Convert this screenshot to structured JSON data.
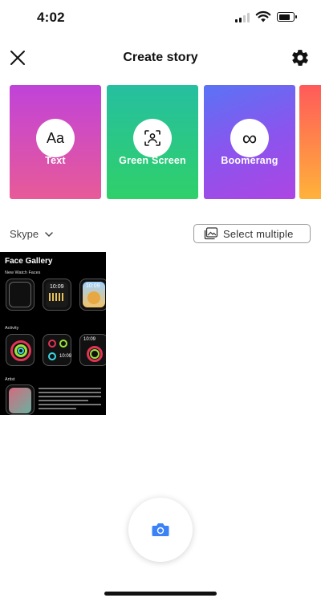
{
  "status_bar": {
    "time": "4:02"
  },
  "header": {
    "title": "Create story"
  },
  "cards": [
    {
      "label": "Text",
      "icon": "text-aa-icon",
      "icon_text": "Aa",
      "colors": [
        "#c043d9",
        "#e85a98"
      ]
    },
    {
      "label": "Green Screen",
      "icon": "green-screen-icon",
      "colors": [
        "#27c09a",
        "#2fd06a"
      ]
    },
    {
      "label": "Boomerang",
      "icon": "infinity-icon",
      "icon_text": "∞",
      "colors": [
        "#5b6cf2",
        "#a54ae6"
      ]
    },
    {
      "label": "",
      "icon": "",
      "colors": [
        "#ff5a5a",
        "#ffb23a"
      ]
    }
  ],
  "gallery": {
    "source_label": "Skype",
    "select_multiple_label": "Select multiple",
    "thumbnail": {
      "title": "Face Gallery",
      "section1": "New Watch Faces",
      "section2": "Activity",
      "section3": "Artist"
    }
  },
  "colors": {
    "camera_blue": "#3b82f6",
    "text_dark": "#111111"
  }
}
